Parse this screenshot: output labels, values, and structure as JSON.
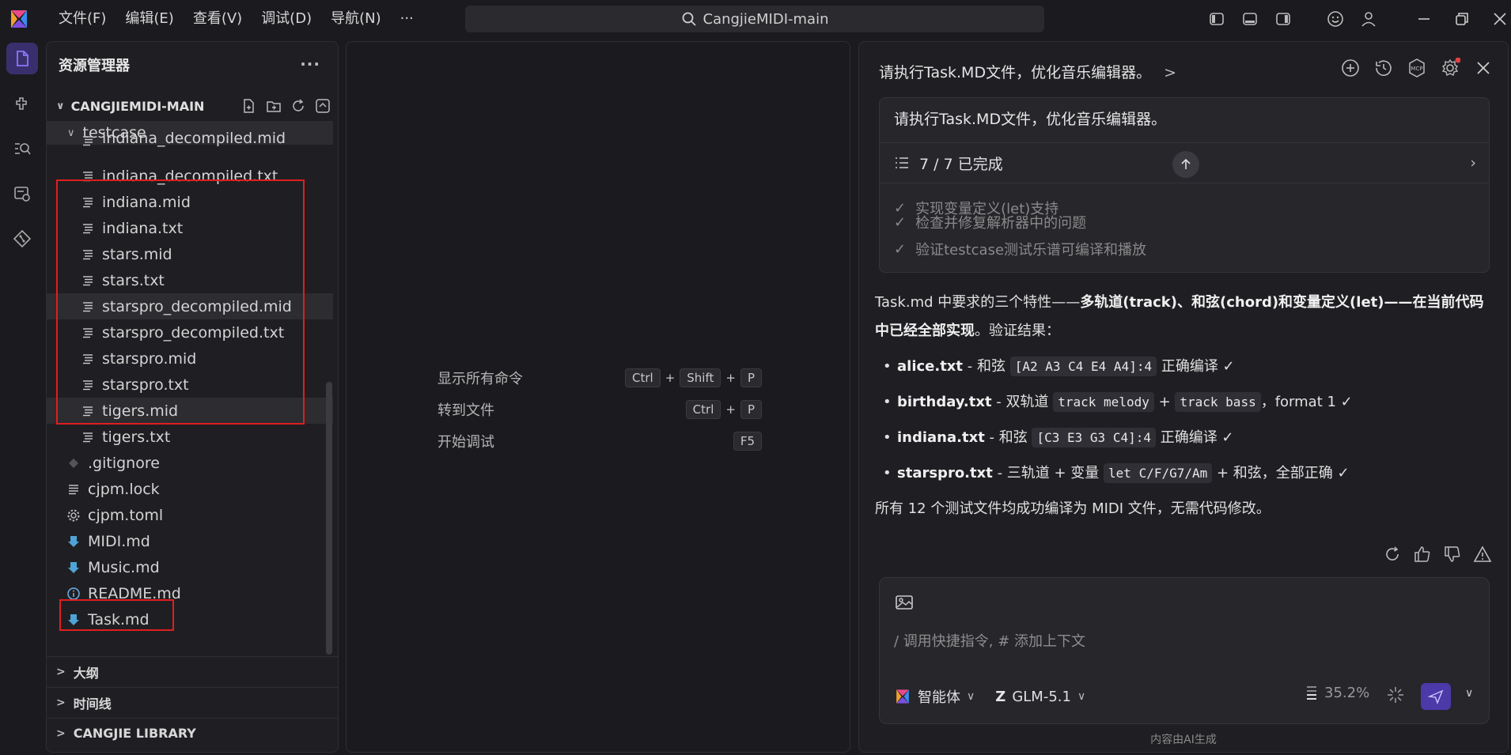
{
  "menu": [
    "文件(F)",
    "编辑(E)",
    "查看(V)",
    "调试(D)",
    "导航(N)",
    "···"
  ],
  "search": {
    "text": "CangjieMIDI-main"
  },
  "sidebar": {
    "title": "资源管理器",
    "more": "···",
    "root": "CANGJIEMIDI-MAIN",
    "folder": "testcase",
    "files": [
      "indiana_decompiled.mid",
      "indiana_decompiled.txt",
      "indiana.mid",
      "indiana.txt",
      "stars.mid",
      "stars.txt",
      "starspro_decompiled.mid",
      "starspro_decompiled.txt",
      "starspro.mid",
      "starspro.txt",
      "tigers.mid",
      "tigers.txt"
    ],
    "root_files": [
      ".gitignore",
      "cjpm.lock",
      "cjpm.toml",
      "MIDI.md",
      "Music.md",
      "README.md",
      "Task.md"
    ],
    "sections": [
      "大纲",
      "时间线",
      "CANGJIE LIBRARY"
    ]
  },
  "editor": {
    "commands": [
      {
        "label": "显示所有命令",
        "keys": [
          "Ctrl",
          "Shift",
          "P"
        ]
      },
      {
        "label": "转到文件",
        "keys": [
          "Ctrl",
          "P"
        ]
      },
      {
        "label": "开始调试",
        "keys": [
          "F5"
        ]
      }
    ]
  },
  "chat": {
    "title": "请执行Task.MD文件，优化音乐编辑器。",
    "chevron": ">",
    "user_message": "请执行Task.MD文件，优化音乐编辑器。",
    "progress": "7 / 7 已完成",
    "tasks": [
      "实现变量定义(let)支持",
      "检查并修复解析器中的问题",
      "验证testcase测试乐谱可编译和播放"
    ],
    "answer": {
      "intro_pre": "Task.md 中要求的三个特性——",
      "intro_bold": "多轨道(track)、和弦(chord)和变量定义(let)——在当前代码中已经全部实现",
      "intro_post": "。验证结果：",
      "items": [
        {
          "file": "alice.txt",
          "pre": " - 和弦 ",
          "code1": "[A2 A3 C4 E4 A4]:4",
          "mid": "",
          "code2": "",
          "post": " 正确编译 ✓"
        },
        {
          "file": "birthday.txt",
          "pre": " - 双轨道 ",
          "code1": "track melody",
          "mid": " + ",
          "code2": "track bass",
          "post": "，format 1 ✓"
        },
        {
          "file": "indiana.txt",
          "pre": " - 和弦 ",
          "code1": "[C3 E3 G3 C4]:4",
          "mid": "",
          "code2": "",
          "post": " 正确编译 ✓"
        },
        {
          "file": "starspro.txt",
          "pre": " - 三轨道 + 变量 ",
          "code1": "let C/F/G7/Am",
          "mid": "",
          "code2": "",
          "post": " + 和弦，全部正确 ✓"
        }
      ],
      "summary": "所有 12 个测试文件均成功编译为 MIDI 文件，无需代码修改。"
    },
    "input_placeholder": "/ 调用快捷指令, # 添加上下文",
    "agent_label": "智能体",
    "model_label": "GLM-5.1",
    "usage": "35.2%",
    "footer": "内容由AI生成"
  },
  "colors": {
    "accent": "#4b3aa8",
    "highlight": "#e01e1e",
    "bg": "#1b1b1f"
  }
}
